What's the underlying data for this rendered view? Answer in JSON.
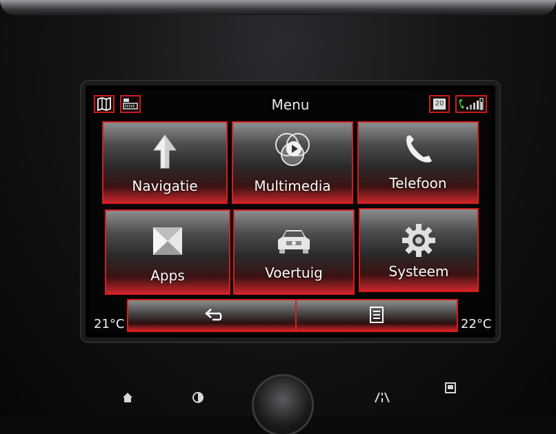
{
  "screen": {
    "title": "Menu",
    "date_badge": "20"
  },
  "menu": {
    "items": [
      {
        "label": "Navigatie",
        "icon": "navigation-arrow-icon"
      },
      {
        "label": "Multimedia",
        "icon": "multimedia-play-icon"
      },
      {
        "label": "Telefoon",
        "icon": "phone-icon"
      },
      {
        "label": "Apps",
        "icon": "apps-icon"
      },
      {
        "label": "Voertuig",
        "icon": "car-icon"
      },
      {
        "label": "Systeem",
        "icon": "gear-icon"
      }
    ]
  },
  "footer": {
    "temp_left": "21°C",
    "temp_right": "22°C"
  },
  "colors": {
    "accent": "#d71d1d",
    "text": "#ffffff"
  }
}
